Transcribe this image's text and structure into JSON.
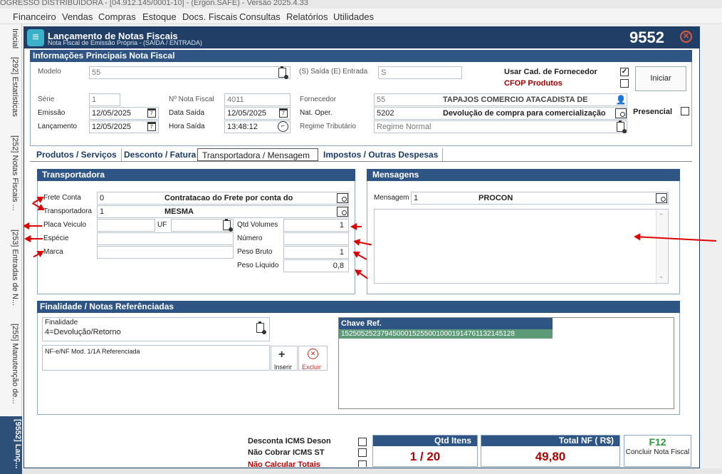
{
  "app": {
    "title_bar": "OGRESSO DISTRIBUIDORA - [04.912.145/0001-10] - (Ergon.SAFE) - Versão 2025.4.33",
    "menu": [
      "Financeiro",
      "Vendas",
      "Compras",
      "Estoque",
      "Docs. Fiscais",
      "Consultas",
      "Relatórios",
      "Utilidades"
    ]
  },
  "side_tabs": [
    {
      "label": "Inicial"
    },
    {
      "label": "[292] Estatísticas"
    },
    {
      "label": "[252] Notas Fiscais ..."
    },
    {
      "label": "[253] Entradas de N..."
    },
    {
      "label": "[255] Manutenção de..."
    },
    {
      "label": "[9552] Lanç..."
    }
  ],
  "window": {
    "title": "Lançamento de Notas Fiscais",
    "subtitle": "Nota Fiscal de Emissão Própria - (SAÍDA / ENTRADA)",
    "number": "9552",
    "close_glyph": "✕"
  },
  "main_info": {
    "header": "Informações Principais Nota Fiscal",
    "modelo_label": "Modelo",
    "modelo_value": "55",
    "saida_entrada_label": "(S) Saída (E) Entrada",
    "saida_entrada_value": "S",
    "usar_cad_label": "Usar Cad. de Fornecedor",
    "usar_cad_checked": "✓",
    "cfop_label": "CFOP Produtos",
    "iniciar_label": "Iniciar",
    "serie_label": "Série",
    "serie_value": "1",
    "num_nf_label": "Nº Nota Fiscal",
    "num_nf_value": "4011",
    "fornecedor_label": "Fornecedor",
    "fornecedor_code": "55",
    "fornecedor_name": "TAPAJOS COMERCIO ATACADISTA DE",
    "emissao_label": "Emissão",
    "emissao_value": "12/05/2025",
    "data_saida_label": "Data Saída",
    "data_saida_value": "12/05/2025",
    "nat_oper_label": "Nat. Oper.",
    "nat_oper_code": "5202",
    "nat_oper_desc": "Devolução de compra para comercialização",
    "presencial_label": "Presencial",
    "lancamento_label": "Lançamento",
    "lancamento_value": "12/05/2025",
    "hora_saida_label": "Hora Saída",
    "hora_saida_value": "13:48:12",
    "regime_label": "Regime Tributário",
    "regime_value": "Regime Normal"
  },
  "tabs": [
    {
      "label": "Produtos / Serviços"
    },
    {
      "label": "Desconto / Fatura"
    },
    {
      "label": "Transportadora / Mensagem"
    },
    {
      "label": "Impostos / Outras Despesas"
    }
  ],
  "transportadora": {
    "header": "Transportadora",
    "frete_label": "Frete Conta",
    "frete_code": "0",
    "frete_desc": "Contratacao do Frete por conta do",
    "transp_label": "Transportadora",
    "transp_code": "1",
    "transp_name": "MESMA",
    "placa_label": "Placa Veiculo",
    "uf_label": "UF",
    "especie_label": "Espécie",
    "marca_label": "Marca",
    "qtd_vol_label": "Qtd Volumes",
    "qtd_vol_value": "1",
    "numero_label": "Número",
    "peso_bruto_label": "Peso Bruto",
    "peso_bruto_value": "1",
    "peso_liq_label": "Peso Líquido",
    "peso_liq_value": "0,8"
  },
  "mensagens": {
    "header": "Mensagens",
    "mensagem_label": "Mensagem",
    "mensagem_code": "1",
    "mensagem_name": "PROCON"
  },
  "finalidade": {
    "header": "Finalidade / Notas Referênciadas",
    "finalidade_label": "Finalidade",
    "finalidade_value": "4=Devolução/Retorno",
    "nfe_ref_label": "NF-e/NF Mod. 1/1A  Referenciada",
    "inserir_label": "Inserir",
    "excluir_label": "Excluir",
    "chave_header": "Chave Ref.",
    "chave_rows": [
      "15250525237945000152550010001914761132145128"
    ]
  },
  "footer": {
    "desconta_icms_label": "Desconta ICMS Deson",
    "nao_cobrar_label": "Não Cobrar ICMS ST",
    "nao_calcular_label": "Não Calcular Totais",
    "qtd_itens_label": "Qtd Itens",
    "qtd_itens_value": "1 / 20",
    "total_nf_label": "Total NF ( R$)",
    "total_nf_value": "49,80",
    "concluir_key": "F12",
    "concluir_label": "Concluir Nota Fiscal"
  }
}
